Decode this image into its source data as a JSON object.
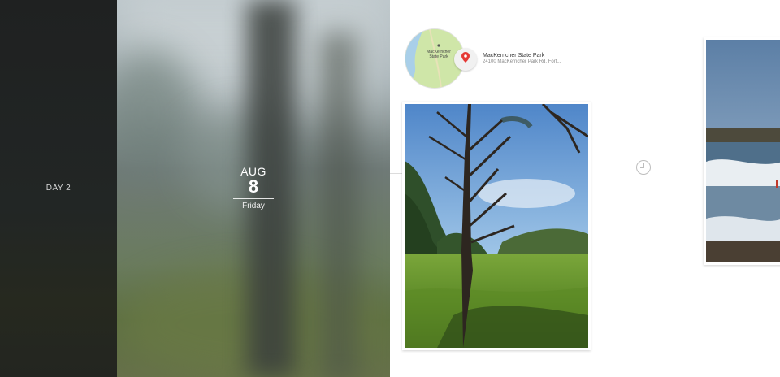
{
  "day_strip": {
    "label": "DAY 2"
  },
  "date": {
    "month": "AUG",
    "day": "8",
    "weekday": "Friday"
  },
  "place": {
    "name": "MacKerricher State Park",
    "address": "24100 MacKerricher Park Rd, Fort...",
    "map_label_line1": "MacKerricher",
    "map_label_line2": "State Park"
  },
  "icons": {
    "pin": "map-pin-icon",
    "clock": "clock-icon"
  },
  "colors": {
    "pin": "#e53935",
    "map_land": "#cfe6a8",
    "map_water": "#a9cfe9"
  }
}
